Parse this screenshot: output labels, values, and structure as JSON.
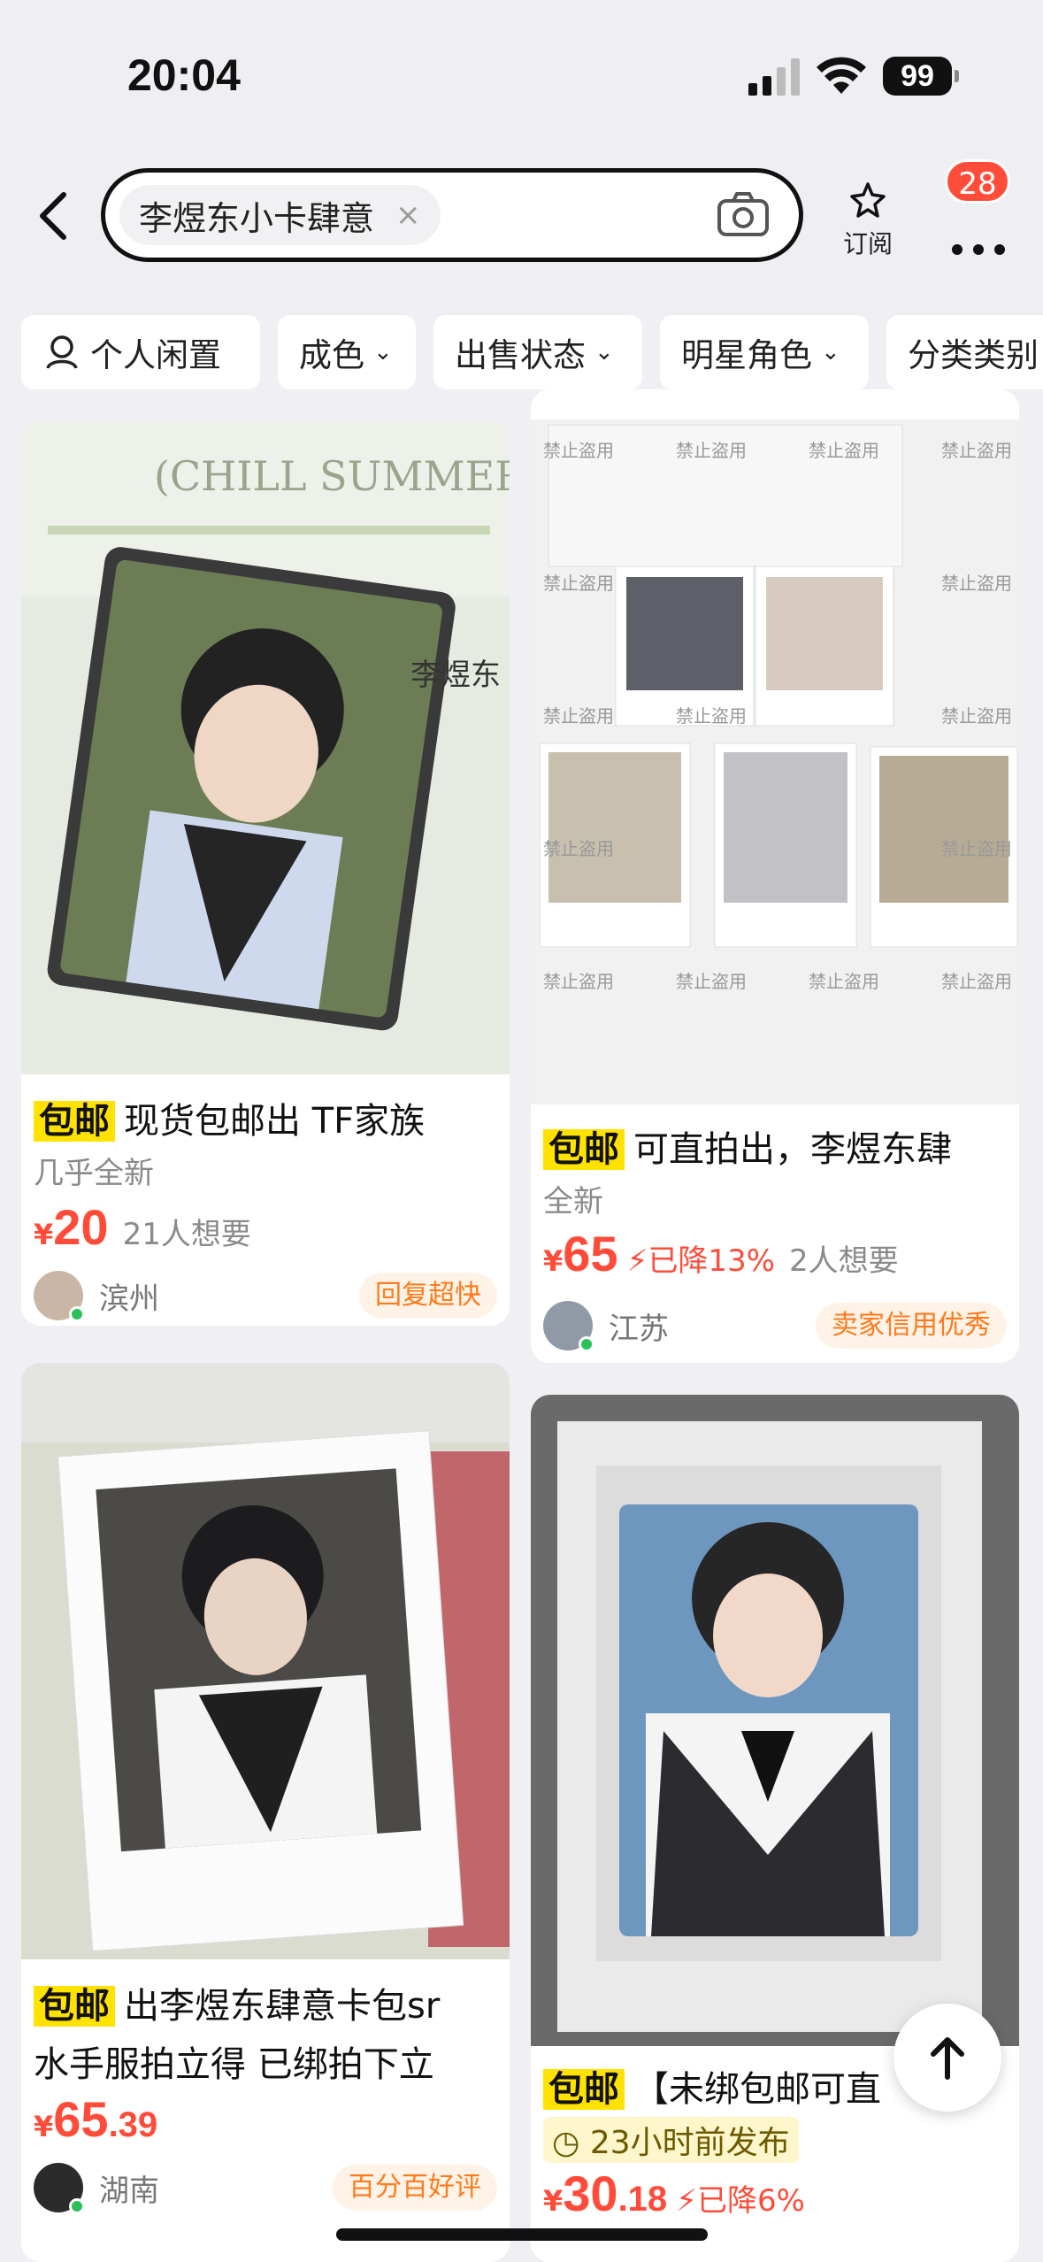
{
  "status_bar": {
    "time": "20:04",
    "battery": "99"
  },
  "header": {
    "search_query": "李煜东小卡肆意",
    "clear_symbol": "×",
    "subscribe_label": "订阅",
    "notification_count": "28"
  },
  "filters": [
    {
      "label": "个人闲置",
      "icon": "person-icon"
    },
    {
      "label": "成色"
    },
    {
      "label": "出售状态"
    },
    {
      "label": "明星角色"
    },
    {
      "label": "分类类别"
    }
  ],
  "items": [
    {
      "tag": "包邮",
      "title": "现货包邮出 TF家族",
      "condition": "几乎全新",
      "price_int": "20",
      "price_dec": "",
      "wants": "21人想要",
      "location": "滨州",
      "badge": "回复超快"
    },
    {
      "tag": "包邮",
      "title": "可直拍出，李煜东肆",
      "condition": "全新",
      "price_int": "65",
      "price_dec": "",
      "drop": "已降13%",
      "wants": "2人想要",
      "location": "江苏",
      "badge": "卖家信用优秀",
      "watermark": "禁止盗用"
    },
    {
      "tag": "包邮",
      "title": "出李煜东肆意卡包sr",
      "title_line2": "水手服拍立得 已绑拍下立",
      "price_int": "65",
      "price_dec": ".39",
      "location": "湖南",
      "badge": "百分百好评"
    },
    {
      "tag": "包邮",
      "title": "【未绑包邮可直",
      "posted": "23小时前发布",
      "price_int": "30",
      "price_dec": ".18",
      "drop": "已降6%"
    }
  ],
  "currency": "¥",
  "colors": {
    "accent": "#ff4c3a",
    "tag_bg": "#ffe200",
    "pill_text": "#ff7a1a"
  }
}
